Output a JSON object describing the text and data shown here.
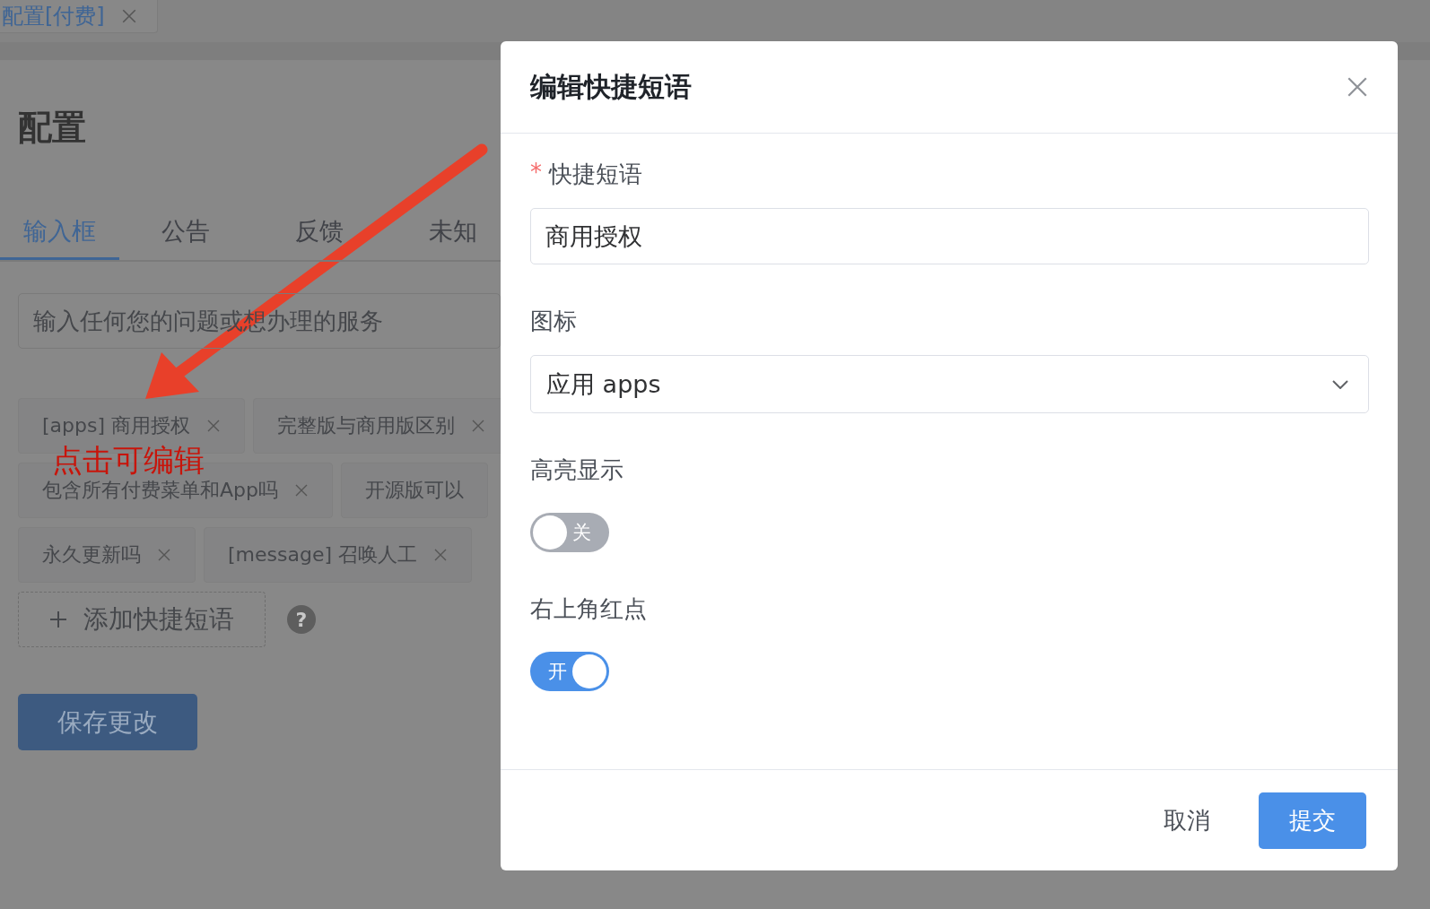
{
  "browser_tab": {
    "label": "配置[付费]"
  },
  "page": {
    "heading": "配置",
    "tabs": [
      {
        "label": "输入框",
        "selected": true
      },
      {
        "label": "公告",
        "selected": false
      },
      {
        "label": "反馈",
        "selected": false
      },
      {
        "label": "未知",
        "selected": false
      }
    ],
    "input": {
      "placeholder": "输入任何您的问题或想办理的服务"
    },
    "chip_rows": [
      {
        "chips": [
          {
            "label": "[apps] 商用授权",
            "closable": true
          },
          {
            "label": "完整版与商用版区别",
            "closable": true
          }
        ]
      },
      {
        "chips": [
          {
            "label": "包含所有付费菜单和App吗",
            "closable": true
          },
          {
            "label": "开源版可以",
            "closable": false
          }
        ]
      },
      {
        "chips": [
          {
            "label": "永久更新吗",
            "closable": true
          },
          {
            "label": "[message] 召唤人工",
            "closable": true
          }
        ]
      }
    ],
    "add_button": "添加快捷短语",
    "help_icon": "?",
    "save_button": "保存更改"
  },
  "annotation": {
    "text": "点击可编辑"
  },
  "dialog": {
    "title": "编辑快捷短语",
    "fields": [
      {
        "kind": "text",
        "label": "快捷短语",
        "required_mark": "*",
        "value": "商用授权"
      },
      {
        "kind": "select",
        "label": "图标",
        "value": "应用 apps"
      },
      {
        "kind": "switch",
        "label": "高亮显示",
        "on": false,
        "state_text": "关"
      },
      {
        "kind": "switch",
        "label": "右上角红点",
        "on": true,
        "state_text": "开"
      }
    ],
    "cancel": "取消",
    "submit": "提交"
  }
}
